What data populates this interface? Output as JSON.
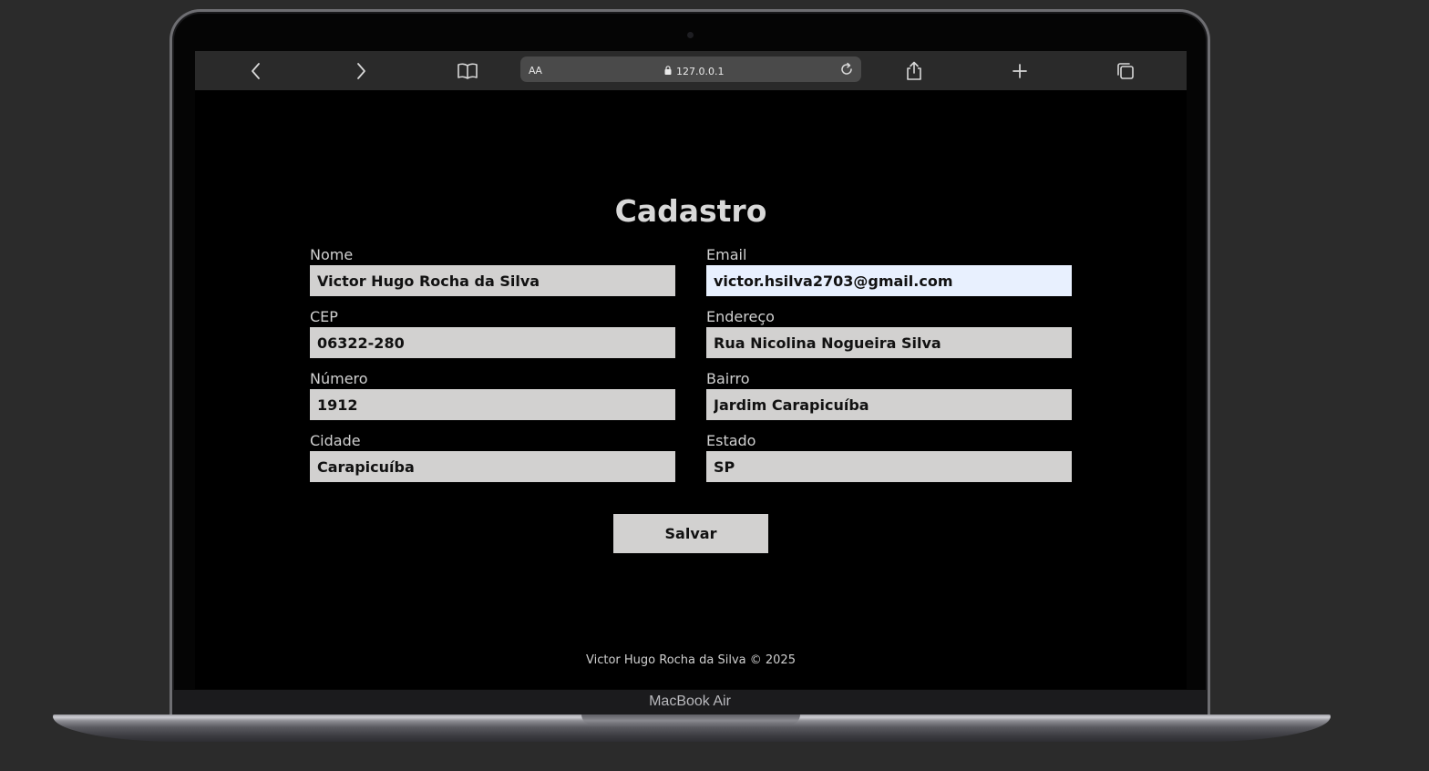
{
  "device": {
    "chin_label": "MacBook Air"
  },
  "browser": {
    "text_size_control": "AA",
    "url": "127.0.0.1",
    "icons": [
      "chevron-left-icon",
      "chevron-right-icon",
      "book-icon",
      "lock-icon",
      "reload-icon",
      "share-icon",
      "plus-icon",
      "tabs-icon"
    ]
  },
  "page": {
    "title": "Cadastro",
    "fields": {
      "nome": {
        "label": "Nome",
        "value": "Victor Hugo Rocha da Silva"
      },
      "email": {
        "label": "Email",
        "value": "victor.hsilva2703@gmail.com"
      },
      "cep": {
        "label": "CEP",
        "value": "06322-280"
      },
      "endereco": {
        "label": "Endereço",
        "value": "Rua Nicolina Nogueira Silva"
      },
      "numero": {
        "label": "Número",
        "value": "1912"
      },
      "bairro": {
        "label": "Bairro",
        "value": "Jardim Carapicuíba"
      },
      "cidade": {
        "label": "Cidade",
        "value": "Carapicuíba"
      },
      "estado": {
        "label": "Estado",
        "value": "SP"
      }
    },
    "save_label": "Salvar",
    "footer": "Victor Hugo Rocha da Silva © 2025"
  },
  "colors": {
    "background": "#2b2b2b",
    "page_background": "#000000",
    "input_background": "#d2d1d0",
    "autofill_background": "#e8f0fe",
    "text_light": "#d8d8d8"
  }
}
